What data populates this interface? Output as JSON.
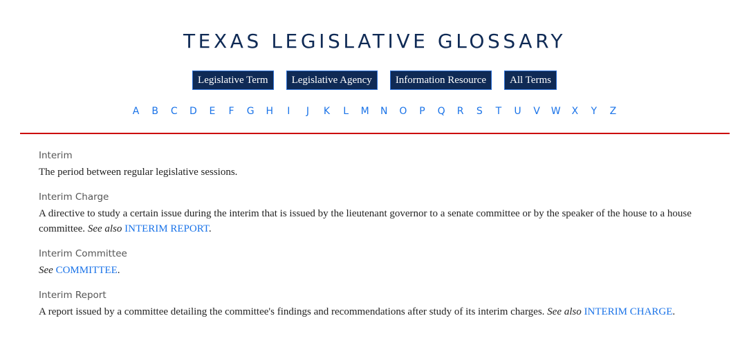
{
  "header": {
    "title": "TEXAS LEGISLATIVE GLOSSARY"
  },
  "filters": [
    {
      "label": "Legislative Term"
    },
    {
      "label": "Legislative Agency"
    },
    {
      "label": "Information Resource"
    },
    {
      "label": "All Terms"
    }
  ],
  "alphabet": [
    "A",
    "B",
    "C",
    "D",
    "E",
    "F",
    "G",
    "H",
    "I",
    "J",
    "K",
    "L",
    "M",
    "N",
    "O",
    "P",
    "Q",
    "R",
    "S",
    "T",
    "U",
    "V",
    "W",
    "X",
    "Y",
    "Z"
  ],
  "colors": {
    "title": "#0f2a55",
    "button_bg": "#0f2a55",
    "button_border": "#2a6fd6",
    "link": "#1a73e8",
    "divider": "#cc0000"
  },
  "entries": [
    {
      "term": "Interim",
      "definition": "The period between regular legislative sessions.",
      "see_prefix": "",
      "see_link": "",
      "suffix": ""
    },
    {
      "term": "Interim Charge",
      "definition": "A directive to study a certain issue during the interim that is issued by the lieutenant governor to a senate committee or by the speaker of the house to a house committee. ",
      "see_prefix": "See also",
      "see_link": "INTERIM REPORT",
      "suffix": "."
    },
    {
      "term": "Interim Committee",
      "definition": "",
      "see_prefix": "See",
      "see_link": "COMMITTEE",
      "suffix": "."
    },
    {
      "term": "Interim Report",
      "definition": "A report issued by a committee detailing the committee's findings and recommendations after study of its interim charges. ",
      "see_prefix": "See also",
      "see_link": "INTERIM CHARGE",
      "suffix": "."
    }
  ]
}
